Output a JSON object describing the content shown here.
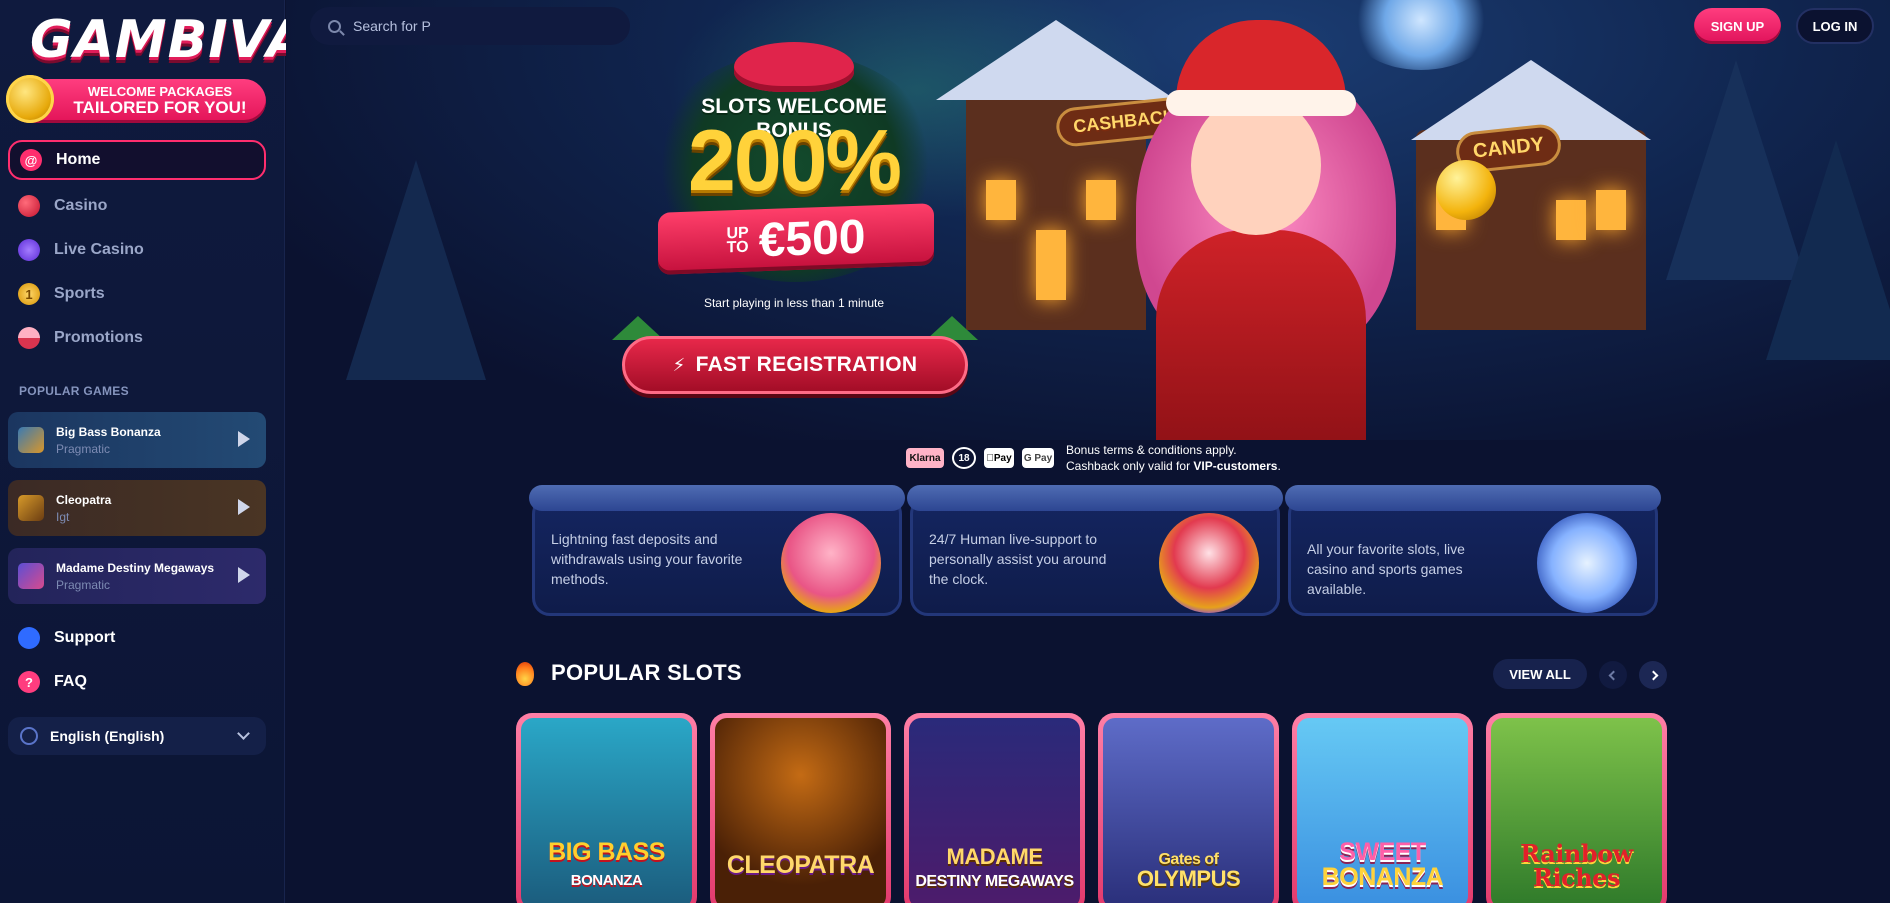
{
  "brand": {
    "logo": "GAMBIVA"
  },
  "welcome_banner": {
    "line1": "WELCOME PACKAGES",
    "line2": "TAILORED FOR YOU!"
  },
  "sidebar": {
    "nav": [
      {
        "label": "Home",
        "icon": "swirl-lollipop-icon",
        "active": true
      },
      {
        "label": "Casino",
        "icon": "cherry-icon"
      },
      {
        "label": "Live Casino",
        "icon": "chip-icon"
      },
      {
        "label": "Sports",
        "icon": "medal-icon"
      },
      {
        "label": "Promotions",
        "icon": "cupcake-icon"
      }
    ],
    "popular_games_title": "POPULAR GAMES",
    "popular_games": [
      {
        "name": "Big Bass Bonanza",
        "provider": "Pragmatic"
      },
      {
        "name": "Cleopatra",
        "provider": "Igt"
      },
      {
        "name": "Madame Destiny Megaways",
        "provider": "Pragmatic"
      }
    ],
    "support": [
      {
        "label": "Support",
        "icon": "headset-icon"
      },
      {
        "label": "FAQ",
        "icon": "question-icon"
      }
    ],
    "language": "English (English)"
  },
  "header": {
    "search_placeholder": "Search for P",
    "signup_label": "SIGN UP",
    "login_label": "LOG IN"
  },
  "hero": {
    "cashback_sign": "CASHBACK 25%",
    "candy_sign": "CANDY",
    "promo_title": "SLOTS WELCOME BONUS",
    "promo_percent": "200%",
    "promo_upto_1": "UP",
    "promo_upto_2": "TO",
    "promo_amount": "€500",
    "promo_sub": "Start playing in less than 1 minute",
    "cta_label": "FAST REGISTRATION"
  },
  "payments": {
    "methods": [
      "Klarna",
      "18",
      "Pay",
      "G Pay"
    ],
    "terms_line1": "Bonus terms & conditions apply.",
    "terms_line2_prefix": "Cashback only valid for ",
    "terms_line2_bold": "VIP-customers",
    "terms_line2_suffix": "."
  },
  "features": [
    {
      "text": "Lightning fast deposits and withdrawals using your favorite methods.",
      "icon": "cake-icon"
    },
    {
      "text": "24/7 Human live-support to personally assist you around the clock.",
      "icon": "alarm-clock-icon"
    },
    {
      "text": "All your favorite slots, live casino and sports games available.",
      "icon": "candy-jar-icon"
    }
  ],
  "popular_slots": {
    "title": "POPULAR SLOTS",
    "view_all": "VIEW ALL",
    "games": [
      {
        "title": "BIG BASS",
        "subtitle": "BONANZA"
      },
      {
        "title": "CLEOPATRA",
        "subtitle": ""
      },
      {
        "title": "MADAME",
        "subtitle": "DESTINY MEGAWAYS"
      },
      {
        "title": "Gates of",
        "subtitle": "OLYMPUS"
      },
      {
        "title": "SWEET",
        "subtitle": "BONANZA"
      },
      {
        "title": "Rainbow",
        "subtitle": "Riches"
      }
    ]
  },
  "colors": {
    "accent": "#ff2e6e",
    "bg": "#0b1230",
    "sidebar": "#0f1a3e"
  }
}
